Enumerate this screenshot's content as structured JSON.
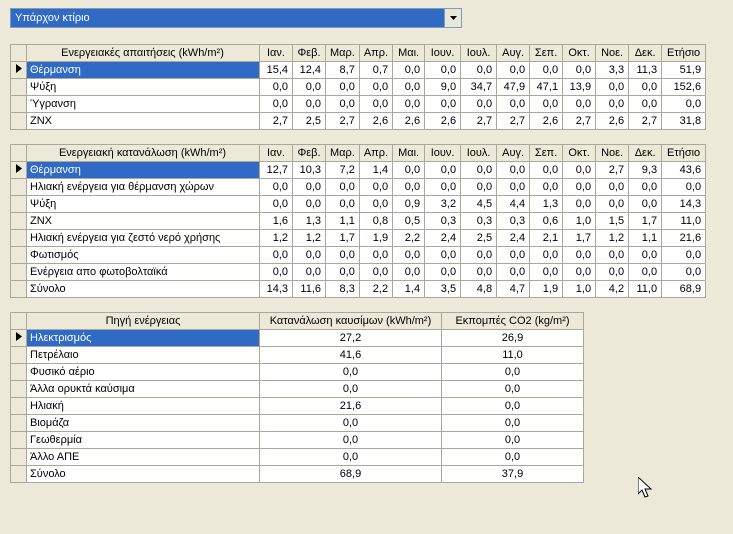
{
  "dropdown": {
    "value": "Υπάρχον κτίριο"
  },
  "months": [
    "Ιαν.",
    "Φεβ.",
    "Μαρ.",
    "Απρ.",
    "Μαι.",
    "Ιουν.",
    "Ιουλ.",
    "Αυγ.",
    "Σεπ.",
    "Οκτ.",
    "Νοε.",
    "Δεκ.",
    "Ετήσιο"
  ],
  "table1": {
    "header": "Ενεργειακές απαιτήσεις (kWh/m²)",
    "rows": [
      {
        "label": "Θέρμανση",
        "sel": true,
        "v": [
          "15,4",
          "12,4",
          "8,7",
          "0,7",
          "0,0",
          "0,0",
          "0,0",
          "0,0",
          "0,0",
          "3,3",
          "11,3",
          "51,9"
        ]
      },
      {
        "label": "Ψύξη",
        "v": [
          "0,0",
          "0,0",
          "0,0",
          "0,0",
          "9,0",
          "34,7",
          "47,9",
          "47,1",
          "13,9",
          "0,0",
          "0,0",
          "152,6"
        ]
      },
      {
        "label": "Ύγρανση",
        "v": [
          "0,0",
          "0,0",
          "0,0",
          "0,0",
          "0,0",
          "0,0",
          "0,0",
          "0,0",
          "0,0",
          "0,0",
          "0,0",
          "0,0"
        ]
      },
      {
        "label": "ΖΝΧ",
        "v": [
          "2,7",
          "2,5",
          "2,7",
          "2,6",
          "2,6",
          "2,6",
          "2,7",
          "2,7",
          "2,6",
          "2,7",
          "2,6",
          "2,7",
          "31,8"
        ]
      }
    ],
    "row0_full": [
      "15,4",
      "12,4",
      "8,7",
      "0,7",
      "0,0",
      "0,0",
      "0,0",
      "0,0",
      "0,0",
      "0,0",
      "3,3",
      "11,3",
      "51,9"
    ],
    "row1_full": [
      "0,0",
      "0,0",
      "0,0",
      "0,0",
      "0,0",
      "9,0",
      "34,7",
      "47,9",
      "47,1",
      "13,9",
      "0,0",
      "0,0",
      "152,6"
    ]
  },
  "table2": {
    "header": "Ενεργειακή κατανάλωση (kWh/m²)",
    "rows": [
      {
        "label": "Θέρμανση",
        "sel": true,
        "v": [
          "12,7",
          "10,3",
          "7,2",
          "1,4",
          "0,0",
          "0,0",
          "0,0",
          "0,0",
          "0,0",
          "0,0",
          "2,7",
          "9,3",
          "43,6"
        ]
      },
      {
        "label": "Ηλιακή ενέργεια για θέρμανση χώρων",
        "v": [
          "0,0",
          "0,0",
          "0,0",
          "0,0",
          "0,0",
          "0,0",
          "0,0",
          "0,0",
          "0,0",
          "0,0",
          "0,0",
          "0,0",
          "0,0"
        ]
      },
      {
        "label": "Ψύξη",
        "v": [
          "0,0",
          "0,0",
          "0,0",
          "0,0",
          "0,9",
          "3,2",
          "4,5",
          "4,4",
          "1,3",
          "0,0",
          "0,0",
          "0,0",
          "14,3"
        ]
      },
      {
        "label": "ΖΝΧ",
        "v": [
          "1,6",
          "1,3",
          "1,1",
          "0,8",
          "0,5",
          "0,3",
          "0,3",
          "0,3",
          "0,6",
          "1,0",
          "1,5",
          "1,7",
          "11,0"
        ]
      },
      {
        "label": "Ηλιακή ενέργεια για ζεστό νερό χρήσης",
        "v": [
          "1,2",
          "1,2",
          "1,7",
          "1,9",
          "2,2",
          "2,4",
          "2,5",
          "2,4",
          "2,1",
          "1,7",
          "1,2",
          "1,1",
          "21,6"
        ]
      },
      {
        "label": "Φωτισμός",
        "v": [
          "0,0",
          "0,0",
          "0,0",
          "0,0",
          "0,0",
          "0,0",
          "0,0",
          "0,0",
          "0,0",
          "0,0",
          "0,0",
          "0,0",
          "0,0"
        ]
      },
      {
        "label": "Ενέργεια απο φωτοβολταϊκά",
        "v": [
          "0,0",
          "0,0",
          "0,0",
          "0,0",
          "0,0",
          "0,0",
          "0,0",
          "0,0",
          "0,0",
          "0,0",
          "0,0",
          "0,0",
          "0,0"
        ]
      },
      {
        "label": "Σύνολο",
        "v": [
          "14,3",
          "11,6",
          "8,3",
          "2,2",
          "1,4",
          "3,5",
          "4,8",
          "4,7",
          "1,9",
          "1,0",
          "4,2",
          "11,0",
          "68,9"
        ]
      }
    ]
  },
  "table3": {
    "headers": [
      "Πηγή ενέργειας",
      "Κατανάλωση καυσίμων (kWh/m²)",
      "Εκπομπές CO2 (kg/m²)"
    ],
    "rows": [
      {
        "label": "Ηλεκτρισμός",
        "sel": true,
        "v": [
          "27,2",
          "26,9"
        ]
      },
      {
        "label": "Πετρέλαιο",
        "v": [
          "41,6",
          "11,0"
        ]
      },
      {
        "label": "Φυσικό αέριο",
        "v": [
          "0,0",
          "0,0"
        ]
      },
      {
        "label": "Άλλα ορυκτά καύσιμα",
        "v": [
          "0,0",
          "0,0"
        ]
      },
      {
        "label": "Ηλιακή",
        "v": [
          "21,6",
          "0,0"
        ]
      },
      {
        "label": "Βιομάζα",
        "v": [
          "0,0",
          "0,0"
        ]
      },
      {
        "label": "Γεωθερμία",
        "v": [
          "0,0",
          "0,0"
        ]
      },
      {
        "label": "Άλλο ΑΠΕ",
        "v": [
          "0,0",
          "0,0"
        ]
      },
      {
        "label": "Σύνολο",
        "v": [
          "68,9",
          "37,9"
        ]
      }
    ]
  }
}
